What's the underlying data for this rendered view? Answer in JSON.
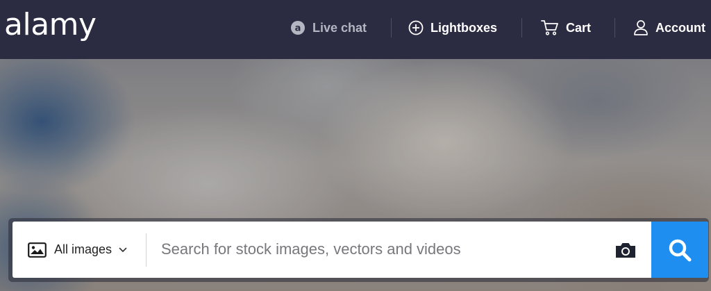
{
  "header": {
    "logo_text": "alamy",
    "nav": {
      "live_chat": "Live chat",
      "lightboxes": "Lightboxes",
      "cart": "Cart",
      "account": "Account"
    },
    "icons": {
      "live_chat": "live-chat-icon",
      "lightboxes": "plus-circle-icon",
      "cart": "cart-icon",
      "account": "user-icon"
    }
  },
  "search": {
    "scope_label": "All images",
    "scope_icon": "image-icon",
    "placeholder": "Search for stock images, vectors and videos",
    "value": "",
    "camera_icon": "camera-icon",
    "submit_icon": "search-icon"
  },
  "colors": {
    "header_bg": "#2b2b42",
    "search_button": "#1e8ff0",
    "live_chat_text": "#b4b6c2"
  }
}
